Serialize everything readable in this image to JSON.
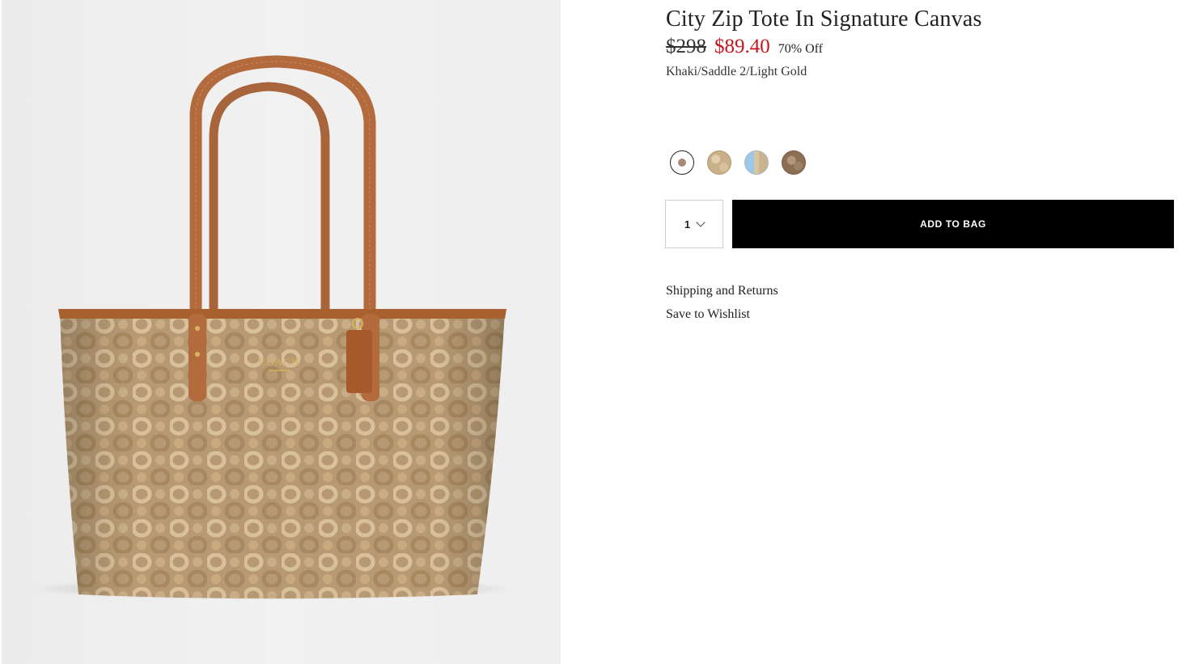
{
  "product": {
    "title": "City Zip Tote In Signature Canvas",
    "price_original": "$298",
    "price_sale": "$89.40",
    "discount": "70% Off",
    "color_name": "Khaki/Saddle 2/Light Gold",
    "image_alt": "City Zip Tote product image",
    "bag_logo": "COACH"
  },
  "swatches": [
    {
      "name": "Khaki/Saddle 2/Light Gold",
      "selected": true
    },
    {
      "name": "Khaki",
      "selected": false
    },
    {
      "name": "Blue",
      "selected": false
    },
    {
      "name": "Brown",
      "selected": false
    }
  ],
  "cart": {
    "quantity": "1",
    "add_to_bag_label": "ADD TO BAG"
  },
  "links": {
    "shipping": "Shipping and Returns",
    "wishlist": "Save to Wishlist"
  },
  "colors": {
    "sale_price": "#c4161c",
    "button_bg": "#000000",
    "button_text": "#ffffff"
  },
  "icons": {
    "quantity_dropdown": "chevron-down-icon"
  }
}
